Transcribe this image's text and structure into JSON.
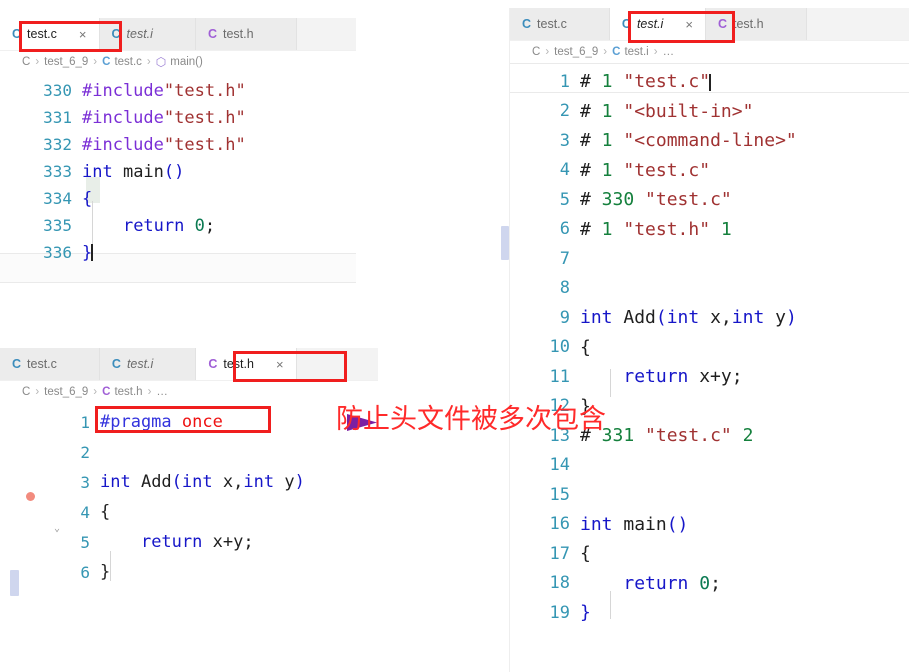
{
  "colors": {
    "annotation_red": "#ff2a2a",
    "box_red": "#f01e1e",
    "arrow_purple": "#7b1fa2",
    "tab_icon_c": "#3c8dbc",
    "tab_icon_h": "#a05fd6",
    "breakpoint": "#f28b7e",
    "keyword_blue": "#1616c8",
    "string_red": "#a03232",
    "preproc_purple": "#7b2fd6",
    "number_green": "#0b7a52"
  },
  "panel_testc": {
    "tabs": [
      {
        "icon": "c-file-icon",
        "icon_letter": "C",
        "label": "test.c",
        "italic": false,
        "active": true,
        "closable": true
      },
      {
        "icon": "c-file-icon",
        "icon_letter": "C",
        "label": "test.i",
        "italic": true,
        "active": false,
        "closable": false
      },
      {
        "icon": "h-file-icon",
        "icon_letter": "C",
        "label": "test.h",
        "italic": false,
        "active": false,
        "closable": false
      }
    ],
    "close_glyph": "×",
    "breadcrumb": {
      "root": "C",
      "folder": "test_6_9",
      "file_icon_letter": "C",
      "file": "test.c",
      "symbol_icon": "⬡",
      "symbol": "main()",
      "separator": "›"
    },
    "lines": [
      {
        "no": "330",
        "tokens": [
          {
            "t": "#include",
            "c": "t-pre"
          },
          {
            "t": "\"test.h\"",
            "c": "t-str"
          }
        ]
      },
      {
        "no": "331",
        "tokens": [
          {
            "t": "#include",
            "c": "t-pre"
          },
          {
            "t": "\"test.h\"",
            "c": "t-str"
          }
        ]
      },
      {
        "no": "332",
        "tokens": [
          {
            "t": "#include",
            "c": "t-pre"
          },
          {
            "t": "\"test.h\"",
            "c": "t-str"
          }
        ]
      },
      {
        "no": "333",
        "tokens": [
          {
            "t": "int ",
            "c": "t-kw"
          },
          {
            "t": "main",
            "c": "t-fn"
          },
          {
            "t": "()",
            "c": "t-par"
          }
        ]
      },
      {
        "no": "334",
        "tokens": [
          {
            "t": "{",
            "c": "t-par"
          }
        ]
      },
      {
        "no": "335",
        "tokens": [
          {
            "t": "    ",
            "c": "t-plain"
          },
          {
            "t": "return ",
            "c": "t-kw"
          },
          {
            "t": "0",
            "c": "t-num"
          },
          {
            "t": ";",
            "c": "t-plain"
          }
        ]
      },
      {
        "no": "336",
        "tokens": [
          {
            "t": "}",
            "c": "t-par"
          }
        ]
      }
    ]
  },
  "panel_testh": {
    "tabs": [
      {
        "icon": "c-file-icon",
        "icon_letter": "C",
        "label": "test.c",
        "italic": false,
        "active": false,
        "closable": false
      },
      {
        "icon": "c-file-icon",
        "icon_letter": "C",
        "label": "test.i",
        "italic": true,
        "active": false,
        "closable": false
      },
      {
        "icon": "h-file-icon",
        "icon_letter": "C",
        "label": "test.h",
        "italic": false,
        "active": true,
        "closable": true
      }
    ],
    "close_glyph": "×",
    "breadcrumb": {
      "root": "C",
      "folder": "test_6_9",
      "file_icon_letter": "C",
      "file": "test.h",
      "symbol_icon": "",
      "symbol": "…",
      "separator": "›"
    },
    "lines": [
      {
        "no": "1",
        "tokens": [
          {
            "t": "#pragma ",
            "c": "t-prg"
          },
          {
            "t": "once",
            "c": "t-red"
          }
        ]
      },
      {
        "no": "2",
        "tokens": []
      },
      {
        "no": "3",
        "tokens": [
          {
            "t": "int ",
            "c": "t-kw"
          },
          {
            "t": "Add",
            "c": "t-fn"
          },
          {
            "t": "(",
            "c": "t-par"
          },
          {
            "t": "int ",
            "c": "t-kw"
          },
          {
            "t": "x,",
            "c": "t-plain"
          },
          {
            "t": "int ",
            "c": "t-kw"
          },
          {
            "t": "y",
            "c": "t-plain"
          },
          {
            "t": ")",
            "c": "t-par"
          }
        ]
      },
      {
        "no": "4",
        "tokens": [
          {
            "t": "{",
            "c": "t-plain"
          }
        ]
      },
      {
        "no": "5",
        "tokens": [
          {
            "t": "    ",
            "c": "t-plain"
          },
          {
            "t": "return ",
            "c": "t-kw"
          },
          {
            "t": "x+y;",
            "c": "t-plain"
          }
        ]
      },
      {
        "no": "6",
        "tokens": [
          {
            "t": "}",
            "c": "t-plain"
          }
        ]
      }
    ],
    "breakpoint_line": "2",
    "fold_caret_line": "3",
    "fold_caret_glyph": "⌄"
  },
  "panel_testi": {
    "tabs": [
      {
        "icon": "c-file-icon",
        "icon_letter": "C",
        "label": "test.c",
        "italic": false,
        "active": false,
        "closable": false
      },
      {
        "icon": "c-file-icon",
        "icon_letter": "C",
        "label": "test.i",
        "italic": true,
        "active": true,
        "closable": true
      },
      {
        "icon": "h-file-icon",
        "icon_letter": "C",
        "label": "test.h",
        "italic": false,
        "active": false,
        "closable": false
      }
    ],
    "close_glyph": "×",
    "breadcrumb": {
      "root": "C",
      "folder": "test_6_9",
      "file_icon_letter": "C",
      "file": "test.i",
      "symbol_icon": "",
      "symbol": "…",
      "separator": "›"
    },
    "lines": [
      {
        "no": "1",
        "tokens": [
          {
            "t": "#",
            "c": "t-hash"
          },
          {
            "t": " 1",
            "c": "t-grn"
          },
          {
            "t": " ",
            "c": "t-plain"
          },
          {
            "t": "\"test.c\"",
            "c": "t-str"
          }
        ]
      },
      {
        "no": "2",
        "tokens": [
          {
            "t": "#",
            "c": "t-hash"
          },
          {
            "t": " 1",
            "c": "t-grn"
          },
          {
            "t": " ",
            "c": "t-plain"
          },
          {
            "t": "\"<built-in>\"",
            "c": "t-str"
          }
        ]
      },
      {
        "no": "3",
        "tokens": [
          {
            "t": "#",
            "c": "t-hash"
          },
          {
            "t": " 1",
            "c": "t-grn"
          },
          {
            "t": " ",
            "c": "t-plain"
          },
          {
            "t": "\"<command-line>\"",
            "c": "t-str"
          }
        ]
      },
      {
        "no": "4",
        "tokens": [
          {
            "t": "#",
            "c": "t-hash"
          },
          {
            "t": " 1",
            "c": "t-grn"
          },
          {
            "t": " ",
            "c": "t-plain"
          },
          {
            "t": "\"test.c\"",
            "c": "t-str"
          }
        ]
      },
      {
        "no": "5",
        "tokens": [
          {
            "t": "#",
            "c": "t-hash"
          },
          {
            "t": " 330",
            "c": "t-grn"
          },
          {
            "t": " ",
            "c": "t-plain"
          },
          {
            "t": "\"test.c\"",
            "c": "t-str"
          }
        ]
      },
      {
        "no": "6",
        "tokens": [
          {
            "t": "#",
            "c": "t-hash"
          },
          {
            "t": " 1",
            "c": "t-grn"
          },
          {
            "t": " ",
            "c": "t-plain"
          },
          {
            "t": "\"test.h\"",
            "c": "t-str"
          },
          {
            "t": " 1",
            "c": "t-grn"
          }
        ]
      },
      {
        "no": "7",
        "tokens": []
      },
      {
        "no": "8",
        "tokens": []
      },
      {
        "no": "9",
        "tokens": [
          {
            "t": "int ",
            "c": "t-blu"
          },
          {
            "t": "Add",
            "c": "t-fn"
          },
          {
            "t": "(",
            "c": "t-blu"
          },
          {
            "t": "int ",
            "c": "t-blu"
          },
          {
            "t": "x,",
            "c": "t-plain"
          },
          {
            "t": "int ",
            "c": "t-blu"
          },
          {
            "t": "y",
            "c": "t-plain"
          },
          {
            "t": ")",
            "c": "t-blu"
          }
        ]
      },
      {
        "no": "10",
        "tokens": [
          {
            "t": "{",
            "c": "t-plain"
          }
        ]
      },
      {
        "no": "11",
        "tokens": [
          {
            "t": "    ",
            "c": "t-plain"
          },
          {
            "t": "return ",
            "c": "t-blu"
          },
          {
            "t": "x+y;",
            "c": "t-plain"
          }
        ]
      },
      {
        "no": "12",
        "tokens": [
          {
            "t": "}",
            "c": "t-plain"
          }
        ]
      },
      {
        "no": "13",
        "tokens": [
          {
            "t": "#",
            "c": "t-hash"
          },
          {
            "t": " 331",
            "c": "t-grn"
          },
          {
            "t": " ",
            "c": "t-plain"
          },
          {
            "t": "\"test.c\"",
            "c": "t-str"
          },
          {
            "t": " 2",
            "c": "t-grn"
          }
        ]
      },
      {
        "no": "14",
        "tokens": []
      },
      {
        "no": "15",
        "tokens": []
      },
      {
        "no": "16",
        "tokens": [
          {
            "t": "int ",
            "c": "t-blu"
          },
          {
            "t": "main",
            "c": "t-fn"
          },
          {
            "t": "()",
            "c": "t-blu"
          }
        ]
      },
      {
        "no": "17",
        "tokens": [
          {
            "t": "{",
            "c": "t-plain"
          }
        ]
      },
      {
        "no": "18",
        "tokens": [
          {
            "t": "    ",
            "c": "t-plain"
          },
          {
            "t": "return ",
            "c": "t-blu"
          },
          {
            "t": "0",
            "c": "t-num"
          },
          {
            "t": ";",
            "c": "t-plain"
          }
        ]
      },
      {
        "no": "19",
        "tokens": [
          {
            "t": "}",
            "c": "t-blu"
          }
        ]
      }
    ]
  },
  "annotation": {
    "chinese_note": "防止头文件被多次包含",
    "highlight_boxes": [
      {
        "name": "testc-tab-highlight"
      },
      {
        "name": "testh-tab-highlight"
      },
      {
        "name": "testi-tab-highlight"
      },
      {
        "name": "pragma-once-highlight"
      }
    ]
  }
}
